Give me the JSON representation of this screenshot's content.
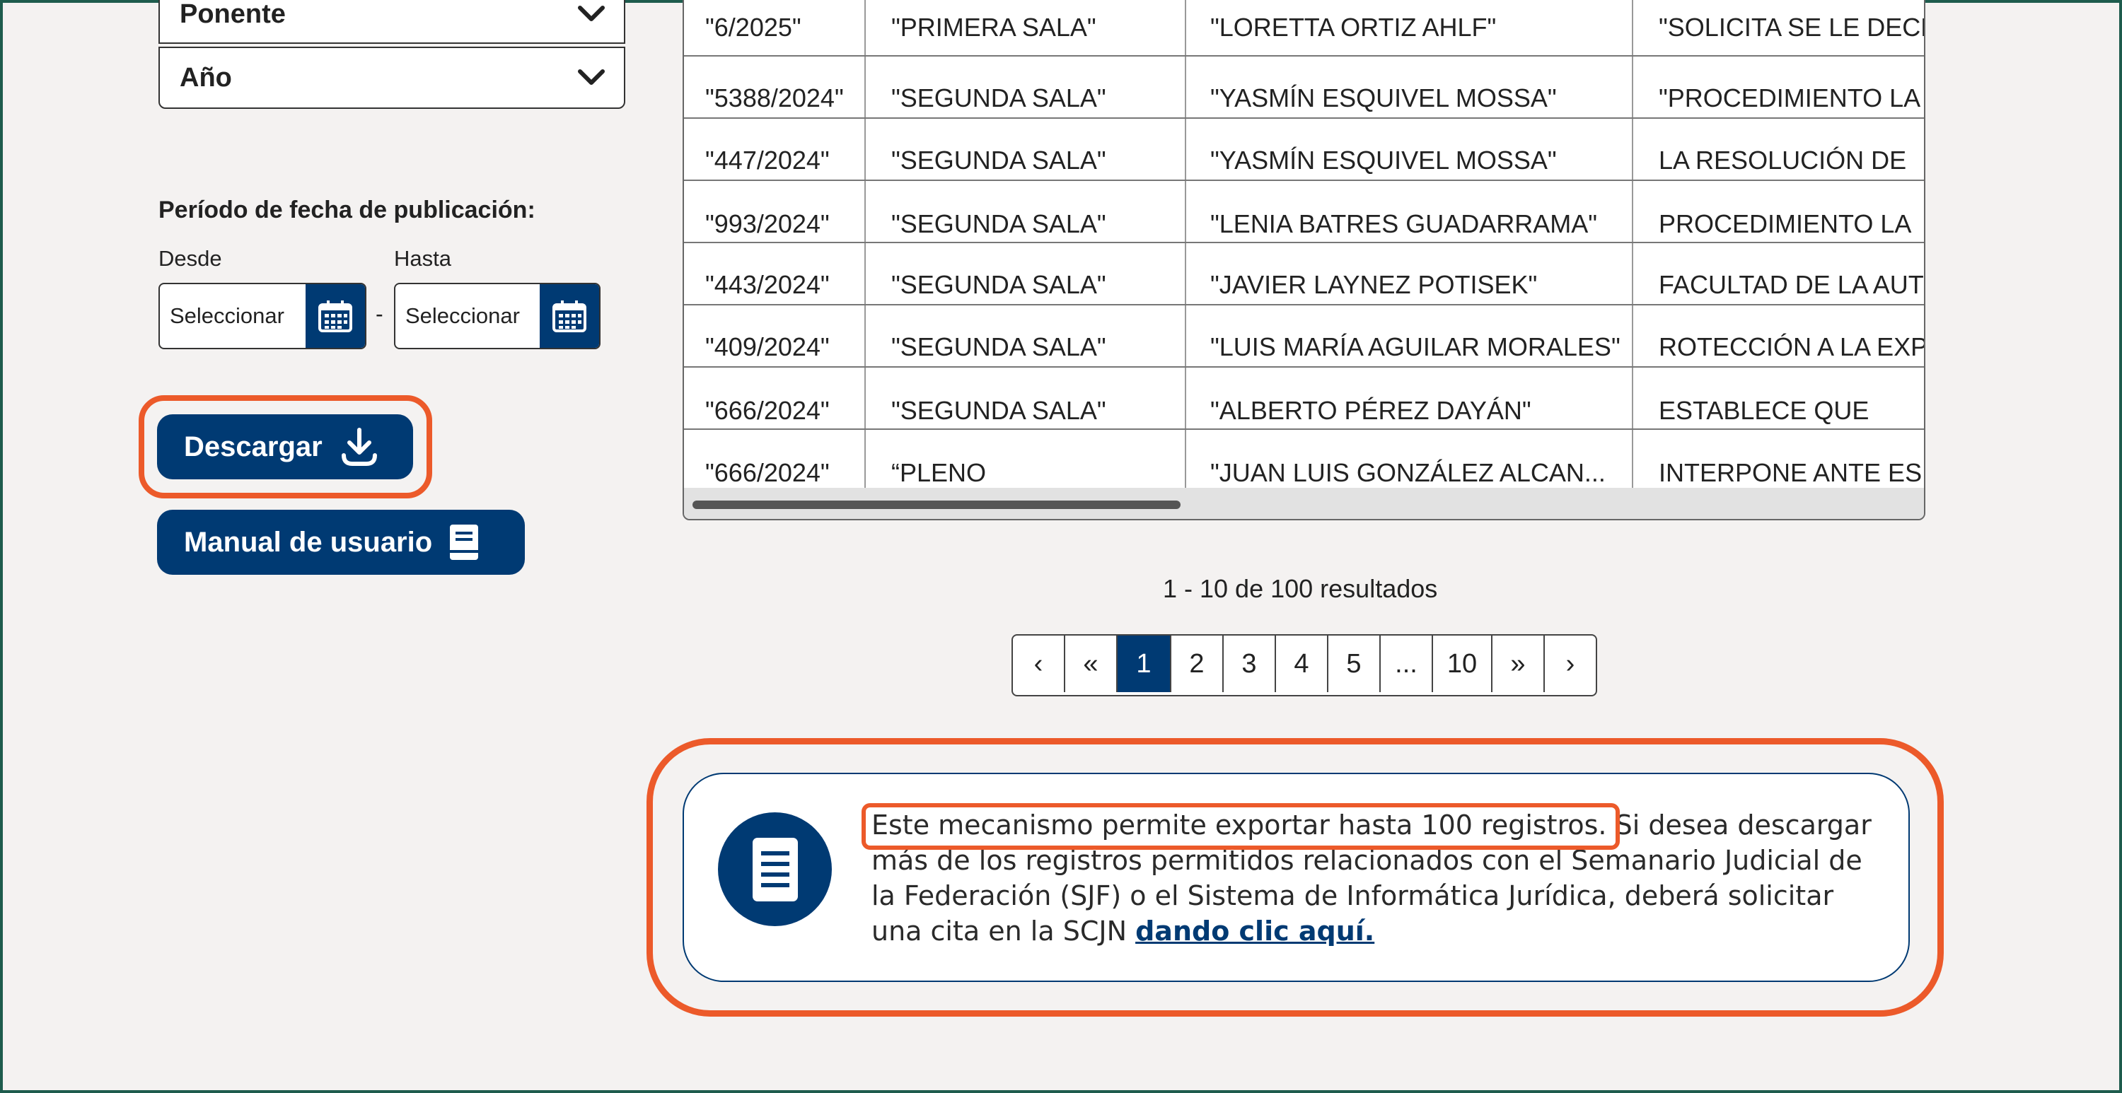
{
  "filters": {
    "ponente_label": "Ponente",
    "ano_label": "Año",
    "period_label": "Período de fecha de publicación:",
    "desde_label": "Desde",
    "hasta_label": "Hasta",
    "desde_value": "Seleccionar",
    "hasta_value": "Seleccionar",
    "separator": "-"
  },
  "buttons": {
    "download_label": "Descargar",
    "manual_label": "Manual de usuario"
  },
  "table": {
    "rows": [
      [
        "\"6/2025\"",
        "\"PRIMERA SALA\"",
        "\"LORETTA ORTIZ AHLF\"",
        "\"SOLICITA SE LE DECL"
      ],
      [
        "\"5388/2024\"",
        "\"SEGUNDA SALA\"",
        "\"YASMÍN ESQUIVEL MOSSA\"",
        "\"PROCEDIMIENTO LA"
      ],
      [
        "\"447/2024\"",
        "\"SEGUNDA SALA\"",
        "\"YASMÍN ESQUIVEL MOSSA\"",
        "LA RESOLUCIÓN DE"
      ],
      [
        "\"993/2024\"",
        "\"SEGUNDA SALA\"",
        "\"LENIA BATRES GUADARRAMA\"",
        "PROCEDIMIENTO LA"
      ],
      [
        "\"443/2024\"",
        "\"SEGUNDA SALA\"",
        "\"JAVIER LAYNEZ POTISEK\"",
        "FACULTAD DE LA AUT"
      ],
      [
        "\"409/2024\"",
        "\"SEGUNDA SALA\"",
        "\"LUIS MARÍA AGUILAR MORALES\"",
        "ROTECCIÓN A LA EXP"
      ],
      [
        "\"666/2024\"",
        "\"SEGUNDA SALA\"",
        "\"ALBERTO PÉREZ DAYÁN\"",
        "ESTABLECE QUE"
      ],
      [
        "\"666/2024\"",
        "“PLENO",
        "\"JUAN LUIS GONZÁLEZ ALCAN...",
        "INTERPONE ANTE ES"
      ]
    ]
  },
  "results_text": "1 - 10 de 100 resultados",
  "pagination": {
    "prev": "‹",
    "first": "«",
    "pages": [
      "1",
      "2",
      "3",
      "4",
      "5",
      "...",
      "10"
    ],
    "last": "»",
    "next": "›",
    "active": "1"
  },
  "info": {
    "highlight_text": "Este mecanismo permite exportar hasta 100 registros.",
    "body_text": " Si desea descargar más de los registros permitidos relacionados con el Semanario Judicial de la Federación (SJF) o el Sistema de Informática Jurídica, deberá solicitar una cita en la SCJN ",
    "link_text": "dando clic aquí."
  },
  "colors": {
    "primary": "#003a73",
    "highlight": "#ec5a2a",
    "background": "#f4f2f1"
  },
  "icons": {
    "dropdown": "chevron-down-icon",
    "date": "calendar-icon",
    "download": "download-icon",
    "manual": "book-icon",
    "info": "document-icon"
  }
}
